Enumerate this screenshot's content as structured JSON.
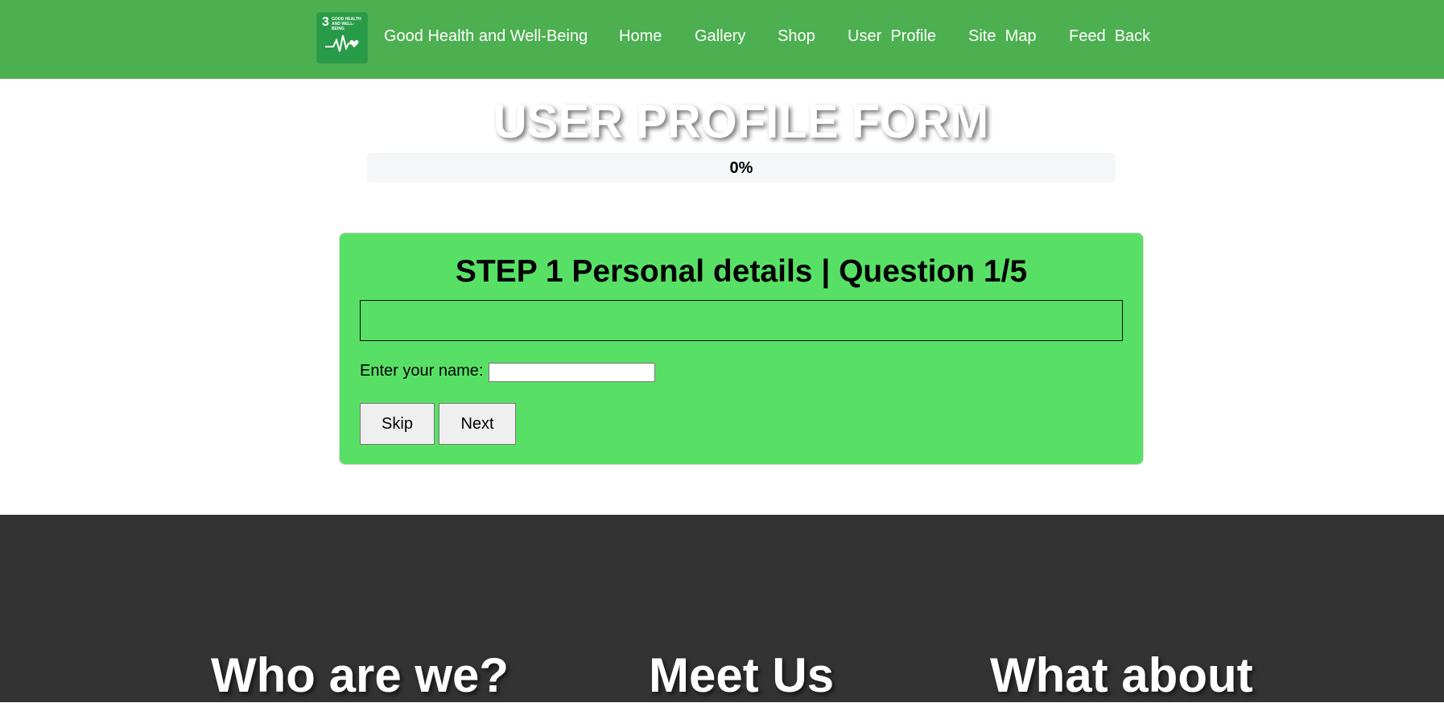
{
  "nav": {
    "logo": {
      "number": "3",
      "text": "GOOD HEALTH AND WELL-BEING"
    },
    "brand": "Good Health and Well-Being",
    "links": [
      "Home",
      "Gallery",
      "Shop",
      "User  Profile",
      "Site  Map",
      "Feed  Back"
    ]
  },
  "page": {
    "title": "USER PROFILE FORM"
  },
  "progress": {
    "value": 0,
    "label": "0%"
  },
  "form": {
    "heading": "STEP 1 Personal details | Question 1/5",
    "name_label": "Enter your name:",
    "name_value": "",
    "skip_label": "Skip",
    "next_label": "Next"
  },
  "footer": {
    "col1": "Who are we?",
    "col2": "Meet Us",
    "col3": "What about"
  },
  "colors": {
    "nav": "#4caf50",
    "card": "#58e066",
    "footer": "#333333"
  }
}
